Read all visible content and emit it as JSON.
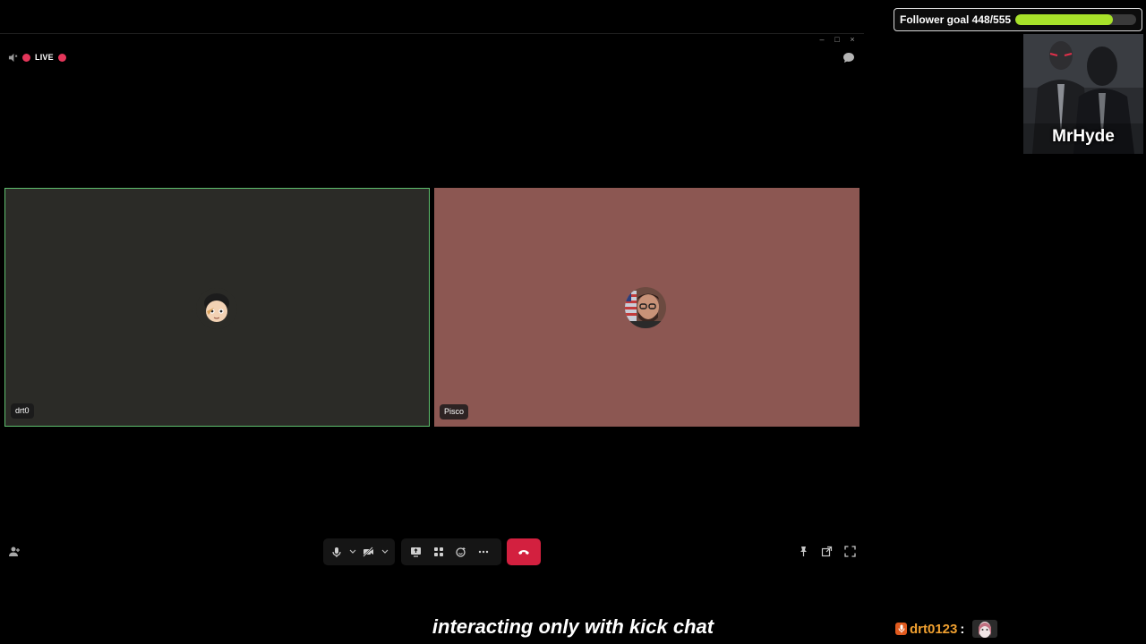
{
  "window": {
    "controls": [
      "–",
      "□",
      "×"
    ]
  },
  "status": {
    "live_label": "LIVE",
    "live_color": "#e4365a"
  },
  "participants": [
    {
      "name": "drt0",
      "tile_color": "#2b2b27",
      "active_speaker": true
    },
    {
      "name": "Pisco",
      "tile_color": "#8c5752",
      "active_speaker": false
    }
  ],
  "toolbar": {
    "icons": [
      "microphone-icon",
      "chevron-down-icon",
      "camera-off-icon",
      "chevron-down-icon",
      "screen-share-icon",
      "apps-icon",
      "reactions-icon",
      "more-icon",
      "hangup-icon"
    ],
    "right_icons": [
      "pin-icon",
      "popout-icon",
      "fullscreen-icon"
    ],
    "hangup_color": "#d3203f"
  },
  "overlay": {
    "goal_label": "Follower goal 448/555",
    "goal_progress": 0.807,
    "goal_color": "#a8e22a",
    "streamer_name": "MrHyde",
    "caption": "interacting only with kick chat",
    "chat_user": "drt0123",
    "chat_colon": ":"
  }
}
